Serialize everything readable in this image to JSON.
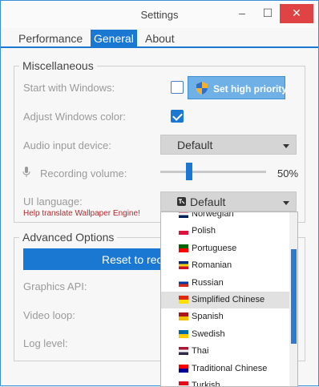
{
  "window": {
    "title": "Settings",
    "minimize": "–",
    "maximize": "☐",
    "close": "✕"
  },
  "tabs": [
    {
      "label": "Performance"
    },
    {
      "label": "General"
    },
    {
      "label": "About"
    }
  ],
  "misc": {
    "title": "Miscellaneous",
    "start_with_windows": {
      "label": "Start with Windows:",
      "checked": false
    },
    "priority_button": "Set high priority",
    "adjust_color": {
      "label": "Adjust Windows color:",
      "checked": true
    },
    "audio_input": {
      "label": "Audio input device:",
      "value": "Default"
    },
    "recording_volume": {
      "label": "Recording volume:",
      "value_text": "50%",
      "value": 0.5
    },
    "ui_language": {
      "label": "UI language:",
      "value": "Default"
    },
    "help_link": "Help translate Wallpaper Engine!"
  },
  "advanced": {
    "title": "Advanced Options",
    "reset_button": "Reset to rec",
    "graphics_api": "Graphics API:",
    "video_loop": "Video loop:",
    "log_level": "Log level:"
  },
  "language_options": [
    {
      "name": "Norwegian",
      "flag_colors": [
        "#ba0c2f",
        "#ffffff",
        "#00205b"
      ]
    },
    {
      "name": "Polish",
      "flag_colors": [
        "#ffffff",
        "#dc143c"
      ]
    },
    {
      "name": "Portuguese",
      "flag_colors": [
        "#006600",
        "#ff0000"
      ]
    },
    {
      "name": "Romanian",
      "flag_colors": [
        "#002b7f",
        "#fcd116",
        "#ce1126"
      ]
    },
    {
      "name": "Russian",
      "flag_colors": [
        "#ffffff",
        "#0039a6",
        "#d52b1e"
      ]
    },
    {
      "name": "Simplified Chinese",
      "flag_colors": [
        "#de2910",
        "#ffde00"
      ],
      "selected": true
    },
    {
      "name": "Spanish",
      "flag_colors": [
        "#aa151b",
        "#f1bf00"
      ]
    },
    {
      "name": "Swedish",
      "flag_colors": [
        "#006aa7",
        "#fecc00"
      ]
    },
    {
      "name": "Thai",
      "flag_colors": [
        "#a51931",
        "#f4f5f8",
        "#2d2a4a"
      ]
    },
    {
      "name": "Traditional Chinese",
      "flag_colors": [
        "#fe0000",
        "#000095"
      ]
    },
    {
      "name": "Turkish",
      "flag_colors": [
        "#e30a17",
        "#ffffff"
      ]
    }
  ],
  "colors": {
    "accent": "#1b78d2",
    "close": "#e04343",
    "link": "#b3292f"
  }
}
